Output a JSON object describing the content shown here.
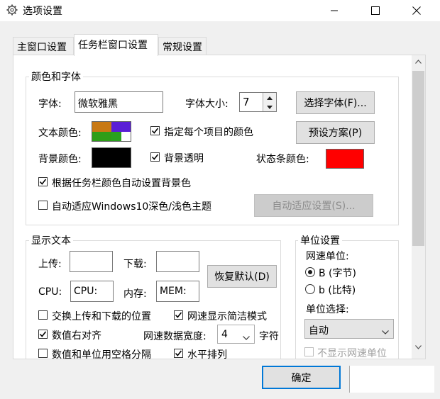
{
  "window": {
    "title": "选项设置",
    "icon": "gear-icon"
  },
  "tabs": [
    {
      "label": "主窗口设置",
      "active": false
    },
    {
      "label": "任务栏窗口设置",
      "active": true
    },
    {
      "label": "常规设置",
      "active": false
    }
  ],
  "color_font": {
    "group_title": "颜色和字体",
    "font_label": "字体:",
    "font_value": "微软雅黑",
    "font_size_label": "字体大小:",
    "font_size_value": "7",
    "select_font_button": "选择字体(F)...",
    "text_color_label": "文本颜色:",
    "text_color_swatches": [
      "#c87914",
      "#2e9e18",
      "#5a1ed6",
      "#2aa120",
      "#ffffff"
    ],
    "per_item_color_label": "指定每个项目的颜色",
    "per_item_color_checked": true,
    "preset_button": "预设方案(P)",
    "bg_color_label": "背景颜色:",
    "bg_color": "#000000",
    "bg_transparent_label": "背景透明",
    "bg_transparent_checked": true,
    "status_bar_color_label": "状态条颜色:",
    "status_bar_color": "#ff0000",
    "auto_bg_label": "根据任务栏颜色自动设置背景色",
    "auto_bg_checked": true,
    "auto_theme_label": "自动适应Windows10深色/浅色主题",
    "auto_theme_checked": false,
    "auto_adapt_button": "自动适应设置(S)..."
  },
  "display_text": {
    "group_title": "显示文本",
    "upload_label": "上传:",
    "upload_value": "",
    "download_label": "下载:",
    "download_value": "",
    "restore_default_button": "恢复默认(D)",
    "cpu_label": "CPU:",
    "cpu_value": "CPU:",
    "memory_label": "内存:",
    "memory_value": "MEM:",
    "swap_label": "交换上传和下载的位置",
    "swap_checked": false,
    "compact_speed_label": "网速显示简洁模式",
    "compact_speed_checked": true,
    "right_align_label": "数值右对齐",
    "right_align_checked": true,
    "data_width_label": "网速数据宽度:",
    "data_width_value": "4",
    "data_width_unit": "字符",
    "space_sep_label": "数值和单位用空格分隔",
    "space_sep_checked": false,
    "horizontal_label": "水平排列",
    "horizontal_checked": true
  },
  "unit_settings": {
    "group_title": "单位设置",
    "speed_unit_label": "网速单位:",
    "radio_byte_label": "B (字节)",
    "radio_byte_checked": true,
    "radio_bit_label": "b (比特)",
    "radio_bit_checked": false,
    "unit_select_label": "单位选择:",
    "unit_select_value": "自动",
    "hide_unit_label": "不显示网速单位",
    "hide_unit_checked": false
  },
  "footer": {
    "ok_button": "确定"
  }
}
